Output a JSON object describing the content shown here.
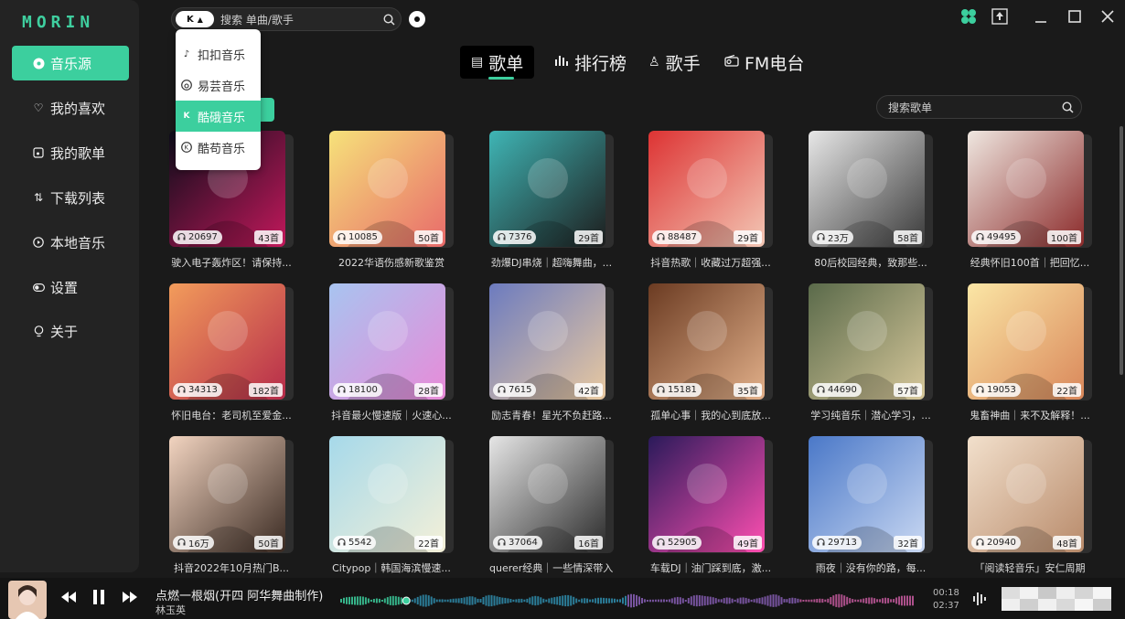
{
  "app": {
    "logo": "MORIN"
  },
  "sidebar": {
    "items": [
      {
        "label": "音乐源",
        "icon": "disc-icon",
        "active": true
      },
      {
        "label": "我的喜欢",
        "icon": "heart-icon"
      },
      {
        "label": "我的歌单",
        "icon": "playlist-icon"
      },
      {
        "label": "下载列表",
        "icon": "download-sort-icon"
      },
      {
        "label": "本地音乐",
        "icon": "play-circle-icon"
      },
      {
        "label": "设置",
        "icon": "toggle-icon"
      },
      {
        "label": "关于",
        "icon": "bulb-icon"
      }
    ]
  },
  "topbar": {
    "source_badge": "K",
    "search_placeholder": "搜索 单曲/歌手"
  },
  "source_dropdown": {
    "items": [
      {
        "label": "扣扣音乐",
        "icon": "music-note-icon"
      },
      {
        "label": "易芸音乐",
        "icon": "netease-icon"
      },
      {
        "label": "酷硪音乐",
        "icon": "kugou-icon",
        "active": true
      },
      {
        "label": "酷苟音乐",
        "icon": "kuwo-icon"
      }
    ]
  },
  "tabs": [
    {
      "label": "歌单",
      "icon": "playlist-icon",
      "active": true
    },
    {
      "label": "排行榜",
      "icon": "bar-chart-icon"
    },
    {
      "label": "歌手",
      "icon": "singer-icon"
    },
    {
      "label": "FM电台",
      "icon": "radio-icon"
    }
  ],
  "playlist_search": {
    "placeholder": "搜索歌单"
  },
  "playlists": [
    {
      "title": "驶入电子轰炸区！请保持...",
      "plays": "20697",
      "count": "43首",
      "c1": "#0d0d1a",
      "c2": "#c2185b"
    },
    {
      "title": "2022华语伤感新歌鉴赏",
      "plays": "10085",
      "count": "50首",
      "c1": "#f6e27a",
      "c2": "#e86a6a"
    },
    {
      "title": "劲爆DJ串烧｜超嗨舞曲，...",
      "plays": "7376",
      "count": "29首",
      "c1": "#3fb5b5",
      "c2": "#1d1d1d"
    },
    {
      "title": "抖音热歌｜收藏过万超强...",
      "plays": "88487",
      "count": "29首",
      "c1": "#d33",
      "c2": "#f3c7b5"
    },
    {
      "title": "80后校园经典，致那些...",
      "plays": "23万",
      "count": "58首",
      "c1": "#e7e7e7",
      "c2": "#3a3a3a"
    },
    {
      "title": "经典怀旧100首｜把回忆...",
      "plays": "49495",
      "count": "100首",
      "c1": "#efe7e0",
      "c2": "#8b2a2a"
    },
    {
      "title": "怀旧电台：老司机至爱金...",
      "plays": "34313",
      "count": "182首",
      "c1": "#f29c5b",
      "c2": "#b62b4a"
    },
    {
      "title": "抖音最火慢速版｜火速心...",
      "plays": "18100",
      "count": "28首",
      "c1": "#a8c4f0",
      "c2": "#e88ad8"
    },
    {
      "title": "励志青春！星光不负赶路...",
      "plays": "7615",
      "count": "42首",
      "c1": "#6c7bbf",
      "c2": "#e9c9a0"
    },
    {
      "title": "孤单心事｜我的心到底放...",
      "plays": "15181",
      "count": "35首",
      "c1": "#6b3b22",
      "c2": "#e2b08a"
    },
    {
      "title": "学习纯音乐｜潜心学习，...",
      "plays": "44690",
      "count": "57首",
      "c1": "#5a6a4a",
      "c2": "#d6c79a"
    },
    {
      "title": "鬼畜神曲｜来不及解释！...",
      "plays": "19053",
      "count": "22首",
      "c1": "#fbe6a5",
      "c2": "#d9875a"
    },
    {
      "title": "抖音2022年10月热门B...",
      "plays": "16万",
      "count": "50首",
      "c1": "#f2d4c0",
      "c2": "#3a2a22"
    },
    {
      "title": "Citypop｜韩国海滨慢速...",
      "plays": "5542",
      "count": "22首",
      "c1": "#a6d9ea",
      "c2": "#f4f0d8"
    },
    {
      "title": "querer经典｜一些情深带入...",
      "plays": "37064",
      "count": "16首",
      "c1": "#e6e6e6",
      "c2": "#2a2a2a"
    },
    {
      "title": "车载DJ｜油门踩到底，激...",
      "plays": "52905",
      "count": "49首",
      "c1": "#2a1a5a",
      "c2": "#ff4fb1"
    },
    {
      "title": "雨夜｜没有你的路，每...",
      "plays": "29713",
      "count": "32首",
      "c1": "#4a78c8",
      "c2": "#c9d8f2"
    },
    {
      "title": "「阅读轻音乐」安仁周期",
      "plays": "20940",
      "count": "48首",
      "c1": "#f2e0cc",
      "c2": "#b88a6a"
    }
  ],
  "player": {
    "title": "点燃一根烟(开四 阿华舞曲制作)",
    "artist": "林玉英",
    "elapsed": "00:18",
    "duration": "02:37",
    "progress": 0.115
  }
}
